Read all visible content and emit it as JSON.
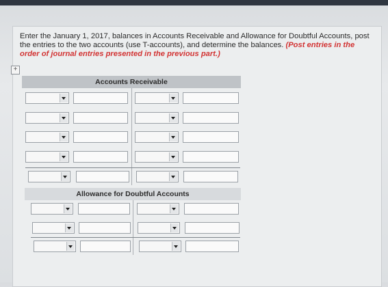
{
  "instructions": {
    "text": "Enter the January 1, 2017, balances in Accounts Receivable and Allowance for Doubtful Accounts, post the entries to the two accounts (use T-accounts), and determine the balances.",
    "red_text": "(Post entries in the order of journal entries presented in the previous part.)"
  },
  "accounts_receivable": {
    "title": "Accounts Receivable"
  },
  "allowance": {
    "title": "Allowance for Doubtful Accounts"
  },
  "icons": {
    "expand": "expand-plus-icon",
    "dropdown": "chevron-down-icon"
  }
}
